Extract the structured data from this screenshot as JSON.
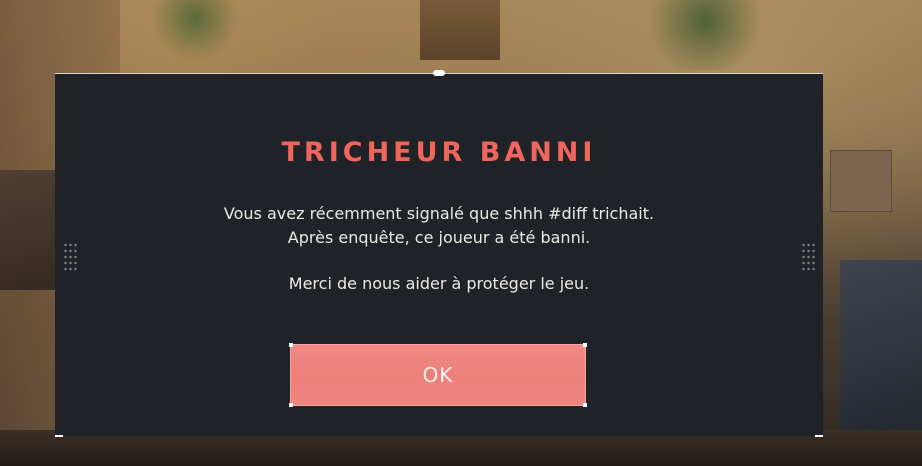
{
  "dialog": {
    "title": "TRICHEUR BANNI",
    "message_line_1": "Vous avez récemment signalé que shhh #diff trichait.",
    "message_line_2": "Après enquête, ce joueur a été banni.",
    "message_line_3": "Merci de nous aider à protéger le jeu.",
    "ok_label": "OK"
  },
  "colors": {
    "title": "#f0665c",
    "panel_background": "#1f2328",
    "button_fill": "#ee7f79",
    "body_text": "#eceae4"
  }
}
